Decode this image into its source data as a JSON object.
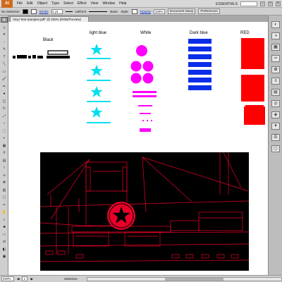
{
  "menubar": {
    "logo": "Ai",
    "items": [
      "File",
      "Edit",
      "Object",
      "Type",
      "Select",
      "Effect",
      "View",
      "Window",
      "Help"
    ],
    "workspace": "ESSENTIALS"
  },
  "controlbar": {
    "selection": "No Selection",
    "stroke_label": "Stroke",
    "stroke_weight": "1 pt",
    "profile": "Uniform",
    "brush": "Basic",
    "style_label": "Style:",
    "opacity_label": "Opacity",
    "opacity_value": "100%",
    "document_setup": "Document Setup",
    "preferences": "Preferences"
  },
  "document": {
    "tab_title": "Vinyl Test Samples.pdf* @ 200% (RGB/Preview)"
  },
  "artboard": {
    "labels": {
      "black": "Black",
      "light_blue": "light blue",
      "white": "White",
      "dark_blue": "Dark blue",
      "red": "RED"
    }
  },
  "colors": {
    "black": "#000000",
    "light_blue": "#00e0f0",
    "white_sample": "#ff00ff",
    "dark_blue": "#0a2ee8",
    "red": "#ff0000",
    "ship_lines": "#e8002a",
    "ship_bg": "#000000"
  },
  "statusbar": {
    "zoom": "200%",
    "page": "1",
    "mode": "Selection"
  },
  "icons": {
    "tools": [
      "selection-tool-icon",
      "direct-selection-tool-icon",
      "magic-wand-tool-icon",
      "lasso-tool-icon",
      "pen-tool-icon",
      "type-tool-icon",
      "line-tool-icon",
      "rectangle-tool-icon",
      "paintbrush-tool-icon",
      "pencil-tool-icon",
      "blob-brush-tool-icon",
      "eraser-tool-icon",
      "rotate-tool-icon",
      "scale-tool-icon",
      "width-tool-icon",
      "free-transform-tool-icon",
      "shape-builder-tool-icon",
      "perspective-grid-tool-icon",
      "mesh-tool-icon",
      "gradient-tool-icon",
      "eyedropper-tool-icon",
      "blend-tool-icon",
      "symbol-sprayer-tool-icon",
      "graph-tool-icon",
      "artboard-tool-icon",
      "slice-tool-icon",
      "hand-tool-icon",
      "zoom-tool-icon",
      "fill-color-icon",
      "stroke-color-icon",
      "swap-colors-icon",
      "draw-mode-icon",
      "screen-mode-icon"
    ],
    "panels": [
      "color-panel-icon",
      "color-guide-icon",
      "swatches-icon",
      "brushes-icon",
      "symbols-icon",
      "stroke-panel-icon",
      "gradient-panel-icon",
      "transparency-panel-icon",
      "appearance-panel-icon",
      "graphic-styles-icon",
      "layers-panel-icon",
      "artboards-panel-icon"
    ]
  }
}
